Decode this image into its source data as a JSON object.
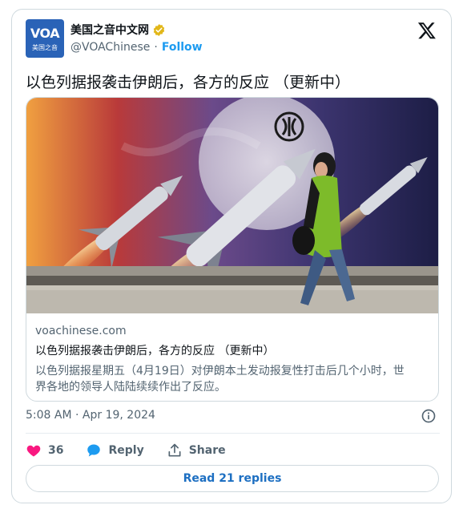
{
  "header": {
    "display_name": "美国之音中文网",
    "handle": "@VOAChinese",
    "separator": "·",
    "follow_label": "Follow",
    "avatar_logo": "VOA",
    "avatar_sub": "美国之音"
  },
  "tweet": {
    "text": "以色列据报袭击伊朗后，各方的反应 （更新中）"
  },
  "link_card": {
    "domain": "voachinese.com",
    "title": "以色列据报袭击伊朗后，各方的反应 （更新中）",
    "description_line1": "以色列据报星期五（4月19日）对伊朗本土发动报复性打击后几个小时，世",
    "description_line2": "界各地的领导人陆陆续续作出了反应。"
  },
  "meta": {
    "timestamp": "5:08 AM · Apr 19, 2024"
  },
  "actions": {
    "like_count": "36",
    "reply_label": "Reply",
    "share_label": "Share"
  },
  "footer": {
    "read_replies_label": "Read 21 replies"
  },
  "colors": {
    "accent_blue": "#1d9bf0",
    "like_pink": "#f91880",
    "verified_gold": "#e2b719",
    "muted_text": "#536471"
  }
}
